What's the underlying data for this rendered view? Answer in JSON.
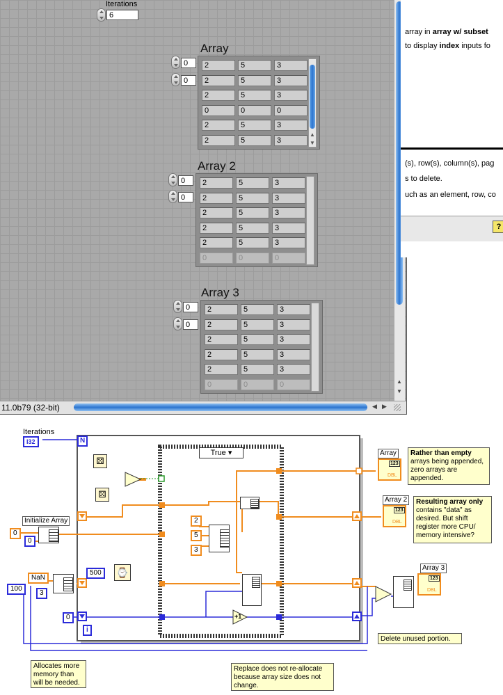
{
  "front_panel": {
    "iterations_label": "Iterations",
    "iterations_value": "6",
    "status_version": "11.0b79 (32-bit)",
    "arrays": [
      {
        "title": "Array",
        "index0": "0",
        "index1": "0",
        "rows": [
          [
            "2",
            "5",
            "3"
          ],
          [
            "2",
            "5",
            "3"
          ],
          [
            "2",
            "5",
            "3"
          ],
          [
            "0",
            "0",
            "0"
          ],
          [
            "2",
            "5",
            "3"
          ],
          [
            "2",
            "5",
            "3"
          ]
        ],
        "dimmed_rows": []
      },
      {
        "title": "Array 2",
        "index0": "0",
        "index1": "0",
        "rows": [
          [
            "2",
            "5",
            "3"
          ],
          [
            "2",
            "5",
            "3"
          ],
          [
            "2",
            "5",
            "3"
          ],
          [
            "2",
            "5",
            "3"
          ],
          [
            "2",
            "5",
            "3"
          ]
        ],
        "dimmed_rows": [
          [
            "0",
            "0",
            "0"
          ]
        ]
      },
      {
        "title": "Array 3",
        "index0": "0",
        "index1": "0",
        "rows": [
          [
            "2",
            "5",
            "3"
          ],
          [
            "2",
            "5",
            "3"
          ],
          [
            "2",
            "5",
            "3"
          ],
          [
            "2",
            "5",
            "3"
          ],
          [
            "2",
            "5",
            "3"
          ]
        ],
        "dimmed_rows": [
          [
            "0",
            "0",
            "0"
          ]
        ]
      }
    ]
  },
  "help_window": {
    "line1_pre": "array in ",
    "line1_bold": "array w/ subset",
    "line2_pre": "to display ",
    "line2_bold": "index",
    "line2_post": " inputs fo",
    "line3": "(s), row(s), column(s), pag",
    "line4": "s to delete.",
    "line5": "uch as an element, row, co",
    "help_icon": "?"
  },
  "block_diagram": {
    "iterations_label": "Iterations",
    "i32_label": "I32",
    "n_label": "N",
    "i_label": "i",
    "case_selector": "True",
    "initialize_array_label": "Initialize Array",
    "const_0_a": "0",
    "const_0_b": "0",
    "const_500": "500",
    "const_100": "100",
    "const_nan": "NaN",
    "const_3": "3",
    "const_0_c": "0",
    "const_2": "2",
    "const_5": "5",
    "const_3b": "3",
    "increment_label": "+1",
    "indicator_array": "Array",
    "indicator_array2": "Array 2",
    "indicator_array3": "Array 3",
    "type_123": "123",
    "type_dbl": "DBL",
    "comment1_bold": "Rather than empty",
    "comment1_rest": "arrays being appended, zero arrays are appended.",
    "comment2_bold": "Resulting array only",
    "comment2_rest": "contains \"data\" as desired.  But shift register more CPU/ memory intensive?",
    "comment3": "Delete unused portion.",
    "comment4": "Allocates more memory than will be needed.",
    "comment5": "Replace does not re-allocate because array size does not change."
  },
  "colors": {
    "wire_orange": "#f08c1e",
    "wire_blue": "#2b2bd9",
    "wire_green": "#2a9a2a",
    "scroll_blue": "#2c74cf"
  }
}
